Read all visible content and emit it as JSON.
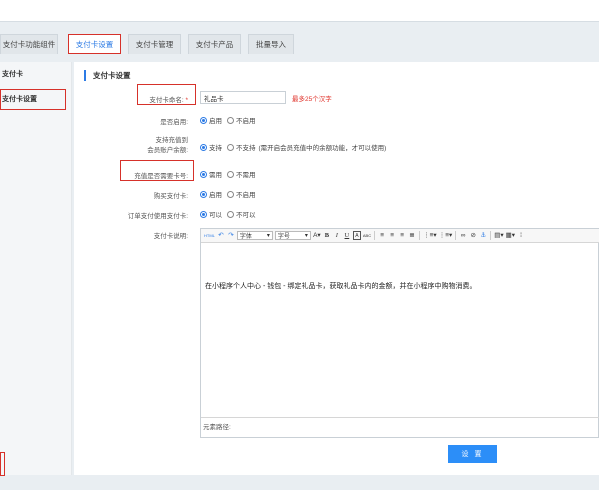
{
  "tabs": [
    {
      "label": "支付卡功能组件",
      "active": false
    },
    {
      "label": "支付卡设置",
      "active": true
    },
    {
      "label": "支付卡管理",
      "active": false
    },
    {
      "label": "支付卡产品",
      "active": false
    },
    {
      "label": "批量导入",
      "active": false
    }
  ],
  "sidebar": {
    "items": [
      {
        "label": "支付卡"
      },
      {
        "label": "支付卡设置"
      }
    ]
  },
  "main": {
    "section_title": "支付卡设置",
    "card_name": {
      "label": "支付卡命名:",
      "required_mark": "*",
      "value": "礼品卡",
      "hint": "最多25个汉字"
    },
    "enabled": {
      "label": "是否启用:",
      "options": [
        "启用",
        "不启用"
      ],
      "selected": 0
    },
    "member_recharge": {
      "label_line1": "支持充值到",
      "label_line2": "会员账户余额:",
      "options": [
        "支持",
        "不支持"
      ],
      "note": "(需开启会员充值中的余额功能，才可以使用)",
      "selected": 0
    },
    "need_card_no": {
      "label": "充值是否需要卡号:",
      "options": [
        "需用",
        "不需用"
      ],
      "selected": 0
    },
    "buy_card": {
      "label": "购买支付卡:",
      "options": [
        "启用",
        "不启用"
      ],
      "selected": 0
    },
    "order_pay": {
      "label": "订单支付使用支付卡:",
      "options": [
        "可以",
        "不可以"
      ],
      "selected": 0
    },
    "description": {
      "label": "支付卡说明:",
      "toolbar": {
        "html_label": "HTML",
        "font_label": "字体",
        "size_label": "字号",
        "bold": "B",
        "italic": "I",
        "underline": "U",
        "A": "A"
      },
      "content": "在小程序个人中心 - 钱包 - 绑定礼品卡，获取礼品卡内的金额，并在小程序中购物消费。",
      "footer": "元素路径:"
    },
    "submit_label": "设 置"
  },
  "colors": {
    "accent": "#2c7be5",
    "required": "#e0332b",
    "highlight": "#d6312a",
    "button": "#2c8ef8"
  }
}
